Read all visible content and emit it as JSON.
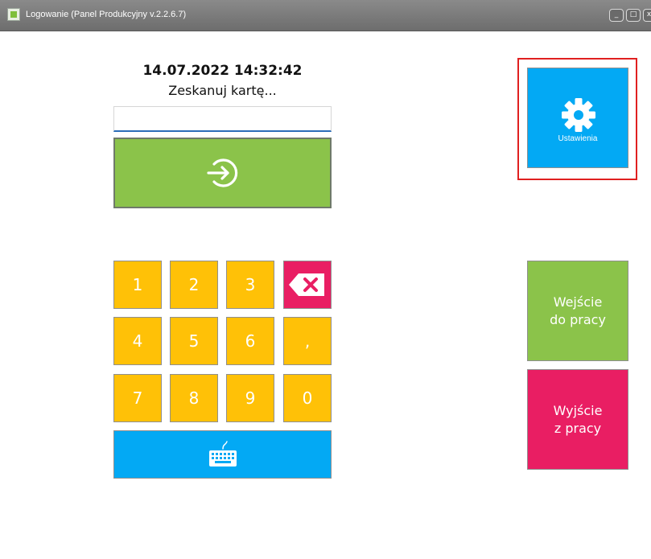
{
  "window": {
    "title": "Logowanie (Panel Produkcyjny v.2.2.6.7)",
    "controls": {
      "minimize": "_",
      "maximize": "□",
      "close": "x"
    }
  },
  "login": {
    "datetime": "14.07.2022 14:32:42",
    "prompt": "Zeskanuj kartę...",
    "card_input_value": "",
    "login_icon": "arrow-right-circle-icon"
  },
  "keypad": {
    "keys": [
      "1",
      "2",
      "3",
      "4",
      "5",
      "6",
      ",",
      "7",
      "8",
      "9",
      "0"
    ],
    "backspace_icon": "backspace-icon",
    "keyboard_icon": "keyboard-icon"
  },
  "settings": {
    "label": "Ustawienia",
    "icon": "gear-icon",
    "highlight_color": "#e02020"
  },
  "actions": {
    "enter_line1": "Wejście",
    "enter_line2": "do pracy",
    "exit_line1": "Wyjście",
    "exit_line2": "z pracy"
  },
  "colors": {
    "green": "#8bc34a",
    "yellow": "#ffc107",
    "pink": "#e91e63",
    "blue": "#03a9f4"
  }
}
